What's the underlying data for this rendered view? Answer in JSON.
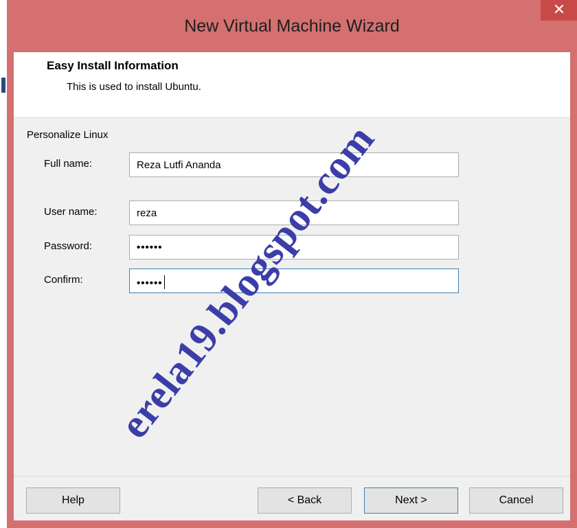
{
  "window": {
    "title": "New Virtual Machine Wizard",
    "close_glyph": "✕"
  },
  "header": {
    "title": "Easy Install Information",
    "subtitle": "This is used to install Ubuntu."
  },
  "form": {
    "group_label": "Personalize Linux",
    "full_name": {
      "label": "Full name:",
      "value": "Reza Lutfi Ananda"
    },
    "user_name": {
      "label": "User name:",
      "value": "reza"
    },
    "password": {
      "label": "Password:",
      "value": "••••••"
    },
    "confirm": {
      "label": "Confirm:",
      "value": "••••••"
    }
  },
  "buttons": {
    "help": "Help",
    "back": "< Back",
    "next": "Next >",
    "cancel": "Cancel"
  },
  "watermark": "erela19.blogspot.com",
  "colors": {
    "titlebar": "#d4706f",
    "close_button": "#c84a46",
    "focus_border": "#3c7fb1",
    "watermark": "#3b3ea8"
  }
}
